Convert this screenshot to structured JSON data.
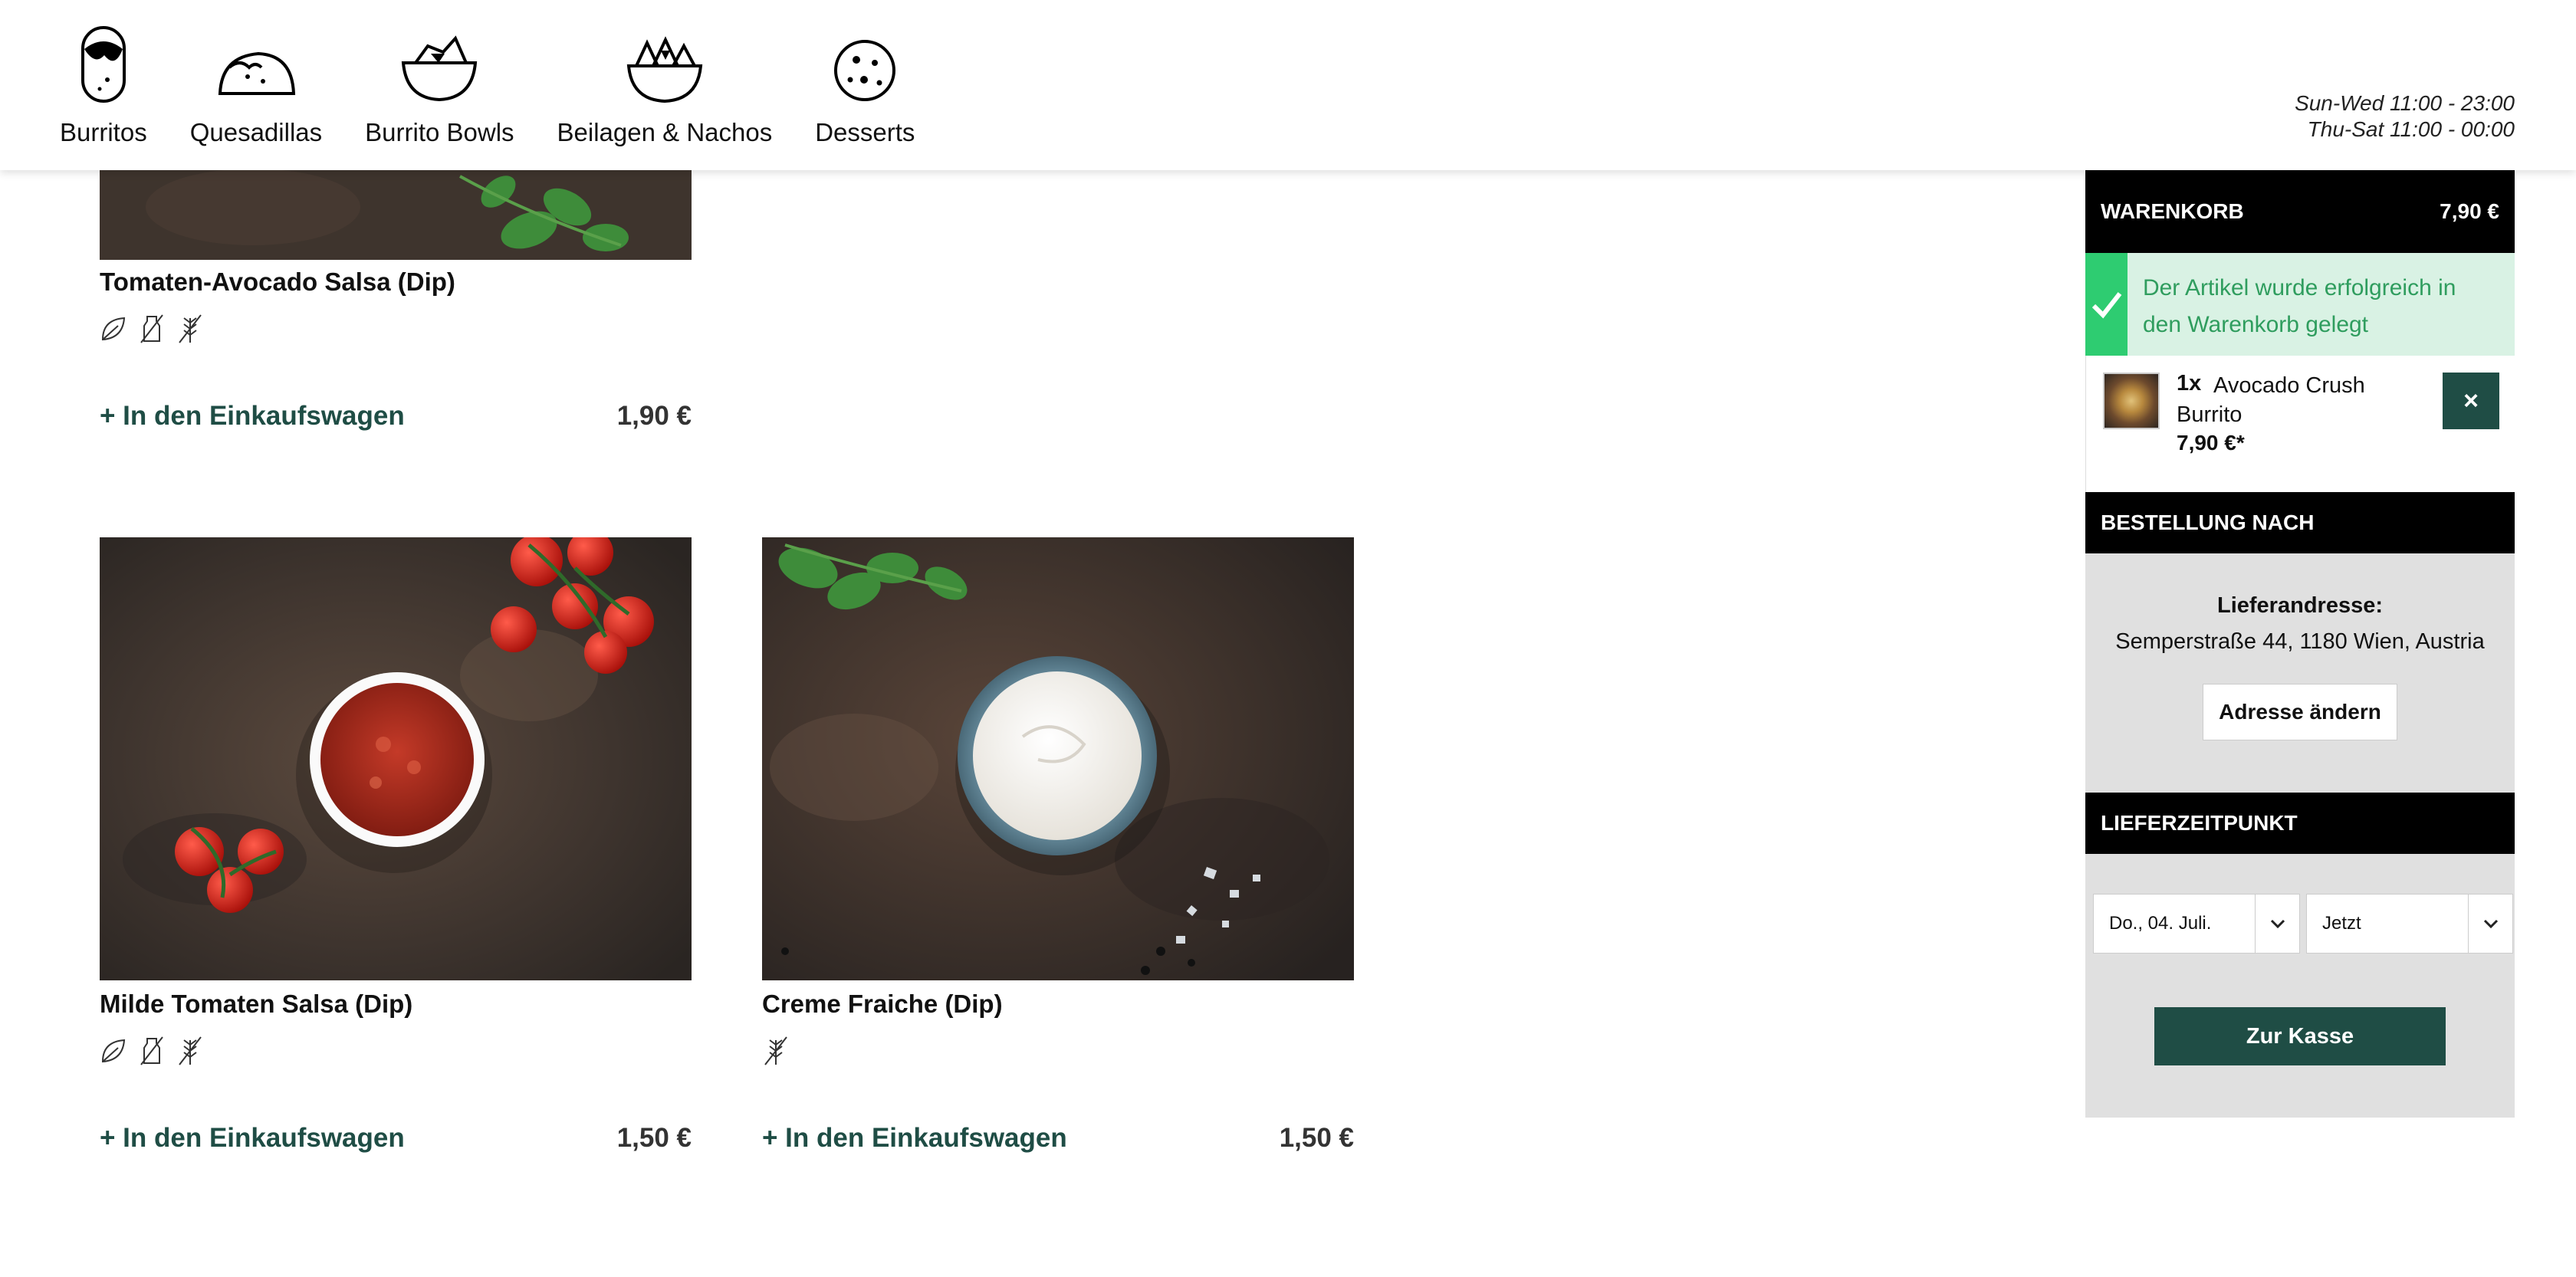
{
  "nav": [
    {
      "label": "Burritos",
      "icon": "burrito-icon"
    },
    {
      "label": "Quesadillas",
      "icon": "quesadilla-icon"
    },
    {
      "label": "Burrito Bowls",
      "icon": "burrito-bowl-icon"
    },
    {
      "label": "Beilagen & Nachos",
      "icon": "nachos-icon"
    },
    {
      "label": "Desserts",
      "icon": "cookie-icon"
    }
  ],
  "hours": {
    "line1": "Sun-Wed 11:00 - 23:00",
    "line2": "Thu-Sat 11:00 - 00:00"
  },
  "products": [
    {
      "title": "Tomaten-Avocado Salsa (Dip)",
      "add_label": "+ In den Einkaufswagen",
      "price": "1,90 €",
      "badges": [
        "vegan-leaf-icon",
        "no-lactose-icon",
        "no-gluten-icon"
      ]
    },
    {
      "title": "Milde Tomaten Salsa (Dip)",
      "add_label": "+ In den Einkaufswagen",
      "price": "1,50 €",
      "badges": [
        "vegan-leaf-icon",
        "no-lactose-icon",
        "no-gluten-icon"
      ]
    },
    {
      "title": "Creme Fraiche (Dip)",
      "add_label": "+ In den Einkaufswagen",
      "price": "1,50 €",
      "badges": [
        "no-gluten-icon"
      ]
    }
  ],
  "cart": {
    "title": "WARENKORB",
    "total": "7,90 €",
    "success_message": "Der Artikel wurde erfolgreich in den Warenkorb gelegt",
    "item": {
      "qty": "1x",
      "name": "Avocado Crush Burrito",
      "price": "7,90 €*",
      "remove": "×"
    }
  },
  "order": {
    "title": "BESTELLUNG NACH",
    "address_label": "Lieferandresse:",
    "address": "Semperstraße 44, 1180 Wien, Austria",
    "change_label": "Adresse ändern"
  },
  "delivery": {
    "title": "LIEFERZEITPUNKT",
    "date": "Do., 04. Juli.",
    "time": "Jetzt",
    "checkout_label": "Zur Kasse"
  },
  "colors": {
    "accent": "#1f4d45",
    "success": "#2ecc71",
    "success_bg": "#d9f2e4",
    "panel_bg": "#e0e0e0"
  }
}
